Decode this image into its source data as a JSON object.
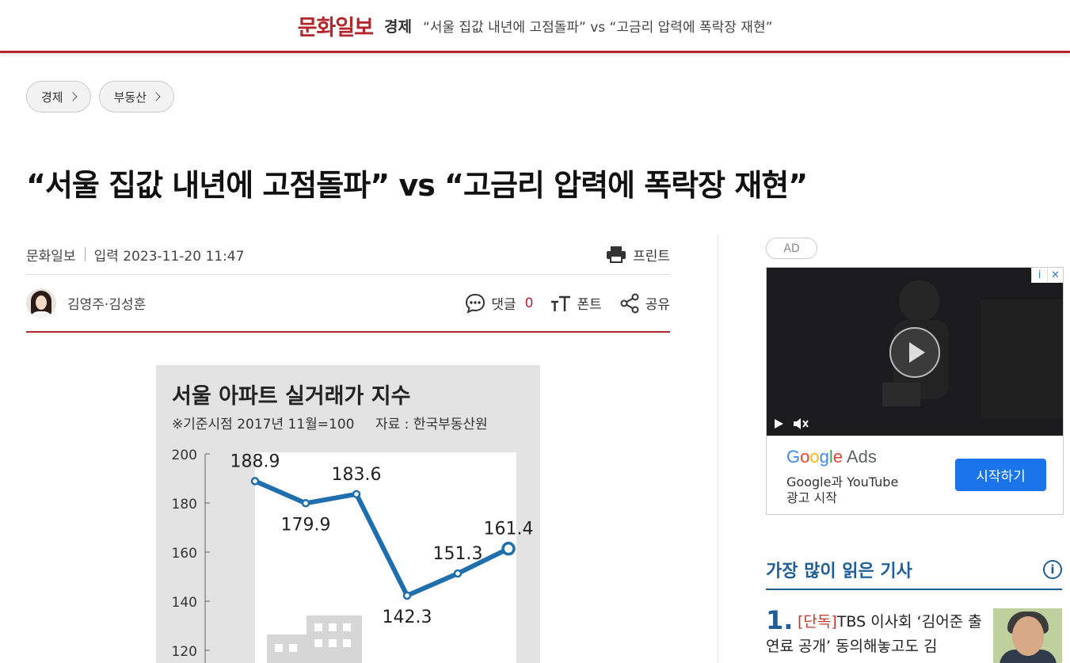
{
  "topbar": {
    "logo": "문화일보",
    "section": "경제",
    "title": "“서울 집값 내년에 고점돌파” vs “고금리 압력에 폭락장 재현”"
  },
  "breadcrumbs": [
    {
      "label": "경제"
    },
    {
      "label": "부동산"
    }
  ],
  "article": {
    "headline": "“서울 집값 내년에 고점돌파” vs “고금리 압력에 폭락장 재현”",
    "source": "문화일보",
    "date": "입력 2023-11-20 11:47",
    "print_label": "프린트",
    "reporters": "김영주·김성훈",
    "comment_label": "댓글",
    "comment_count": "0",
    "font_label": "폰트",
    "share_label": "공유"
  },
  "figure": {
    "title": "서울 아파트 실거래가 지수",
    "note": "※기준시점 2017년 11월=100",
    "source": "자료 : 한국부동산원",
    "y_ticks": [
      "200",
      "180",
      "160",
      "140",
      "120"
    ],
    "line_color": "#1f6fae"
  },
  "chart_data": {
    "type": "line",
    "title": "서울 아파트 실거래가 지수",
    "subtitle": "※기준시점 2017년 11월=100",
    "source": "자료 : 한국부동산원",
    "ylim": [
      120,
      200
    ],
    "yticks": [
      200,
      180,
      160,
      140,
      120
    ],
    "values": [
      188.9,
      179.9,
      183.6,
      142.3,
      151.3,
      161.4
    ],
    "labels": [
      "188.9",
      "179.9",
      "183.6",
      "142.3",
      "151.3",
      "161.4"
    ]
  },
  "ad": {
    "tag": "AD",
    "brand_parts": [
      "G",
      "o",
      "o",
      "g",
      "l",
      "e"
    ],
    "brand_suffix": " Ads",
    "line1": "Google과 YouTube",
    "line2": "광고 시작",
    "cta": "시작하기",
    "info_glyph": "i",
    "close_glyph": "✕"
  },
  "popular": {
    "title": "가장 많이 읽은 기사",
    "info_glyph": "i",
    "items": [
      {
        "rank": "1.",
        "tag": "[단독]",
        "text": "TBS 이사회 ‘김어준 출연료 공개’ 동의해놓고도 김"
      }
    ]
  }
}
